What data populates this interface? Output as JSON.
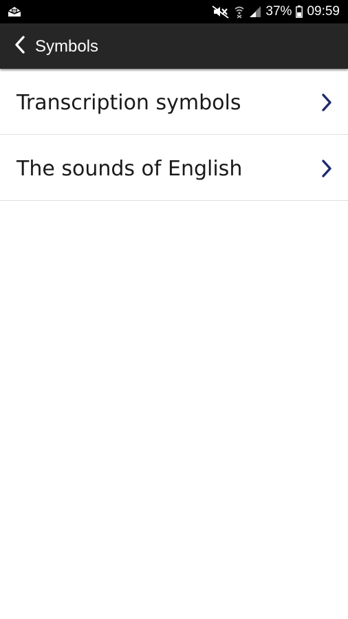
{
  "status_bar": {
    "battery_percent": "37%",
    "time": "09:59",
    "icons": [
      "notification-icon",
      "mute-icon",
      "wifi-icon",
      "signal-icon",
      "battery-icon"
    ]
  },
  "app_bar": {
    "title": "Symbols",
    "back_icon": "back-arrow-icon"
  },
  "list": {
    "items": [
      {
        "label": "Transcription symbols",
        "icon": "chevron-right-icon"
      },
      {
        "label": "The sounds of English",
        "icon": "chevron-right-icon"
      }
    ]
  },
  "colors": {
    "status_bar_bg": "#000000",
    "app_bar_bg": "#262626",
    "chevron": "#1f2a6b",
    "divider": "#dedede"
  }
}
